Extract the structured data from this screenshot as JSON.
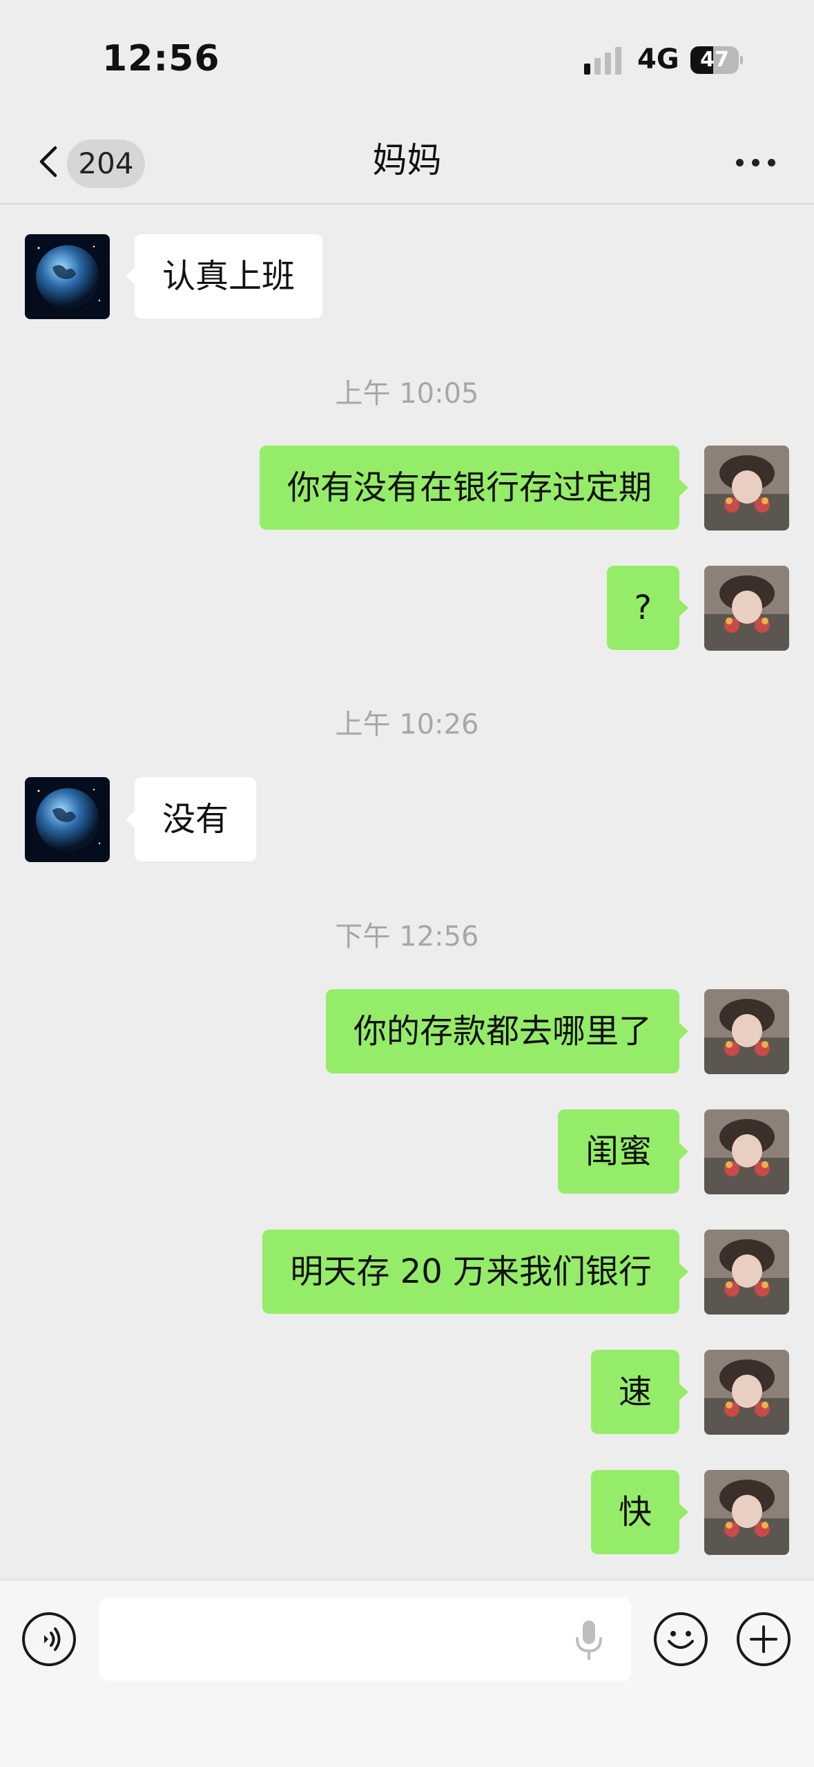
{
  "status_bar": {
    "time": "12:56",
    "network": "4G",
    "battery": "47",
    "battery_level": 0.47
  },
  "nav": {
    "unread_count": "204",
    "title": "妈妈"
  },
  "messages": [
    {
      "side": "in",
      "text": "认真上班"
    },
    {
      "timestamp": "上午 10:05"
    },
    {
      "side": "out",
      "text": "你有没有在银行存过定期"
    },
    {
      "side": "out",
      "text": "?"
    },
    {
      "timestamp": "上午 10:26"
    },
    {
      "side": "in",
      "text": "没有"
    },
    {
      "timestamp": "下午 12:56"
    },
    {
      "side": "out",
      "text": "你的存款都去哪里了"
    },
    {
      "side": "out",
      "text": "闺蜜"
    },
    {
      "side": "out",
      "text": "明天存 20 万来我们银行"
    },
    {
      "side": "out",
      "text": "速"
    },
    {
      "side": "out",
      "text": "快"
    }
  ],
  "input": {
    "placeholder": "",
    "value": ""
  },
  "icons": {
    "back": "chevron-left-icon",
    "more": "more-horizontal-icon",
    "voice": "voice-mode-icon",
    "mic": "microphone-icon",
    "emoji": "emoji-icon",
    "plus": "plus-icon",
    "avatar_contact": "earth-globe-avatar",
    "avatar_self": "user-photo-avatar"
  },
  "colors": {
    "background": "#ededed",
    "bubble_out": "#95ec69",
    "bubble_in": "#ffffff",
    "timestamp": "#a7a7a7"
  }
}
